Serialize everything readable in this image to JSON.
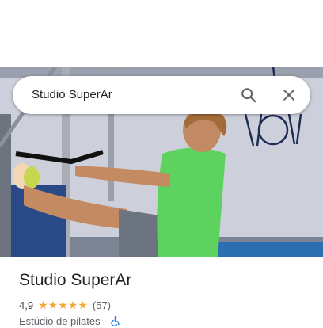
{
  "search": {
    "query": "Studio SuperAr",
    "search_icon": "search-icon",
    "close_icon": "close-icon"
  },
  "photo": {
    "subject": "pilates-studio-photo"
  },
  "place": {
    "name": "Studio SuperAr",
    "rating": "4,9",
    "stars": 5,
    "review_count": "(57)",
    "category": "Estúdio de pilates",
    "separator": "·",
    "accessibility_icon": "wheelchair-icon"
  },
  "colors": {
    "star": "#f2a93b",
    "accessibility": "#1a73e8",
    "shirt": "#5ed25e"
  }
}
